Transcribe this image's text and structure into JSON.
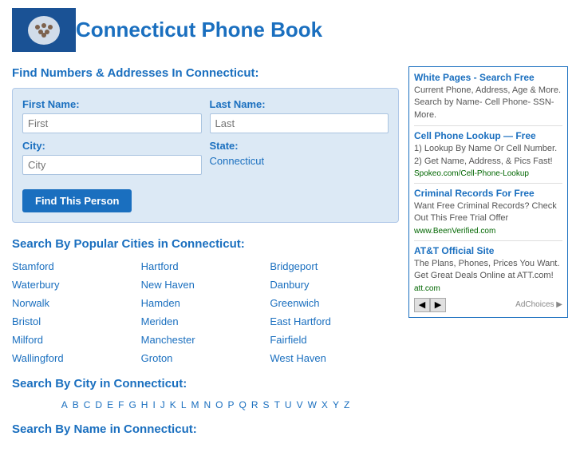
{
  "header": {
    "title": "Connecticut Phone Book"
  },
  "search": {
    "section_title": "Find Numbers & Addresses In Connecticut:",
    "first_name_label": "First Name:",
    "first_name_placeholder": "First",
    "last_name_label": "Last Name:",
    "last_name_placeholder": "Last",
    "city_label": "City:",
    "city_placeholder": "City",
    "state_label": "State:",
    "state_value": "Connecticut",
    "button_label": "Find This Person"
  },
  "popular_cities": {
    "section_title": "Search By Popular Cities in Connecticut:",
    "cities": [
      "Stamford",
      "Hartford",
      "Bridgeport",
      "Waterbury",
      "New Haven",
      "Danbury",
      "Norwalk",
      "Hamden",
      "Greenwich",
      "Bristol",
      "Meriden",
      "East Hartford",
      "Milford",
      "Manchester",
      "Fairfield",
      "Wallingford",
      "Groton",
      "West Haven"
    ]
  },
  "city_search": {
    "section_title": "Search By City in Connecticut:",
    "letters": [
      "A",
      "B",
      "C",
      "D",
      "E",
      "F",
      "G",
      "H",
      "I",
      "J",
      "K",
      "L",
      "M",
      "N",
      "O",
      "P",
      "Q",
      "R",
      "S",
      "T",
      "U",
      "V",
      "W",
      "X",
      "Y",
      "Z"
    ]
  },
  "name_search": {
    "section_title": "Search By Name in Connecticut:"
  },
  "ads": [
    {
      "title": "White Pages - Search Free",
      "text": "Current Phone, Address, Age & More. Search by Name- Cell Phone- SSN- More.",
      "url": ""
    },
    {
      "title": "Cell Phone Lookup — Free",
      "text": "1) Lookup By Name Or Cell Number. 2) Get Name, Address, & Pics Fast!",
      "url": "Spokeo.com/Cell-Phone-Lookup"
    },
    {
      "title": "Criminal Records For Free",
      "text": "Want Free Criminal Records? Check Out This Free Trial Offer",
      "url": "www.BeenVerified.com"
    },
    {
      "title": "AT&T Official Site",
      "text": "The Plans, Phones, Prices You Want. Get Great Deals Online at ATT.com!",
      "url": "att.com"
    }
  ],
  "ad_choices_label": "AdChoices ▶"
}
